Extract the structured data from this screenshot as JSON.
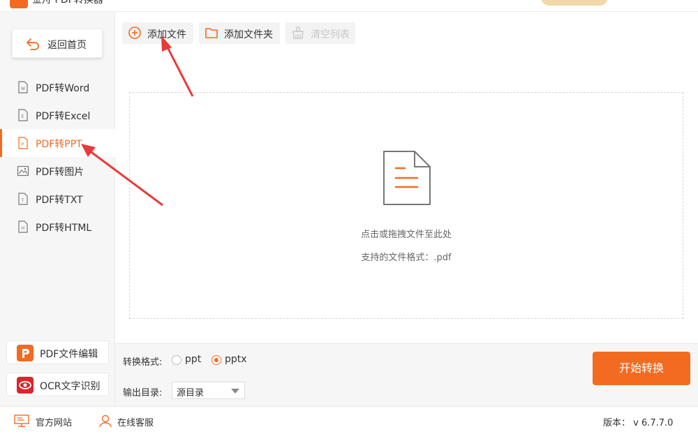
{
  "app": {
    "title": "金舟 PDF转换器"
  },
  "sidebar": {
    "home_label": "返回首页",
    "items": [
      {
        "label": "PDF转Word",
        "icon": "word-file-icon",
        "active": false
      },
      {
        "label": "PDF转Excel",
        "icon": "excel-file-icon",
        "active": false
      },
      {
        "label": "PDF转PPT",
        "icon": "ppt-file-icon",
        "active": true
      },
      {
        "label": "PDF转图片",
        "icon": "image-icon",
        "active": false
      },
      {
        "label": "PDF转TXT",
        "icon": "txt-file-icon",
        "active": false
      },
      {
        "label": "PDF转HTML",
        "icon": "html-file-icon",
        "active": false
      }
    ],
    "tools": [
      {
        "label": "PDF文件编辑",
        "icon": "pdf-edit-icon"
      },
      {
        "label": "OCR文字识别",
        "icon": "ocr-eye-icon"
      }
    ]
  },
  "toolbar": {
    "add_file": "添加文件",
    "add_folder": "添加文件夹",
    "clear_list": "清空列表"
  },
  "dropzone": {
    "hint": "点击或拖拽文件至此处",
    "formats": "支持的文件格式：.pdf"
  },
  "options": {
    "format_label": "转换格式:",
    "formats": [
      {
        "label": "ppt",
        "checked": false
      },
      {
        "label": "pptx",
        "checked": true
      }
    ],
    "output_label": "输出目录:",
    "output_value": "源目录",
    "start_label": "开始转换"
  },
  "status": {
    "website": "官方网站",
    "support": "在线客服",
    "version": "版本： v 6.7.7.0"
  },
  "colors": {
    "accent": "#f26b21",
    "annotation_arrow": "#e83a3a"
  }
}
